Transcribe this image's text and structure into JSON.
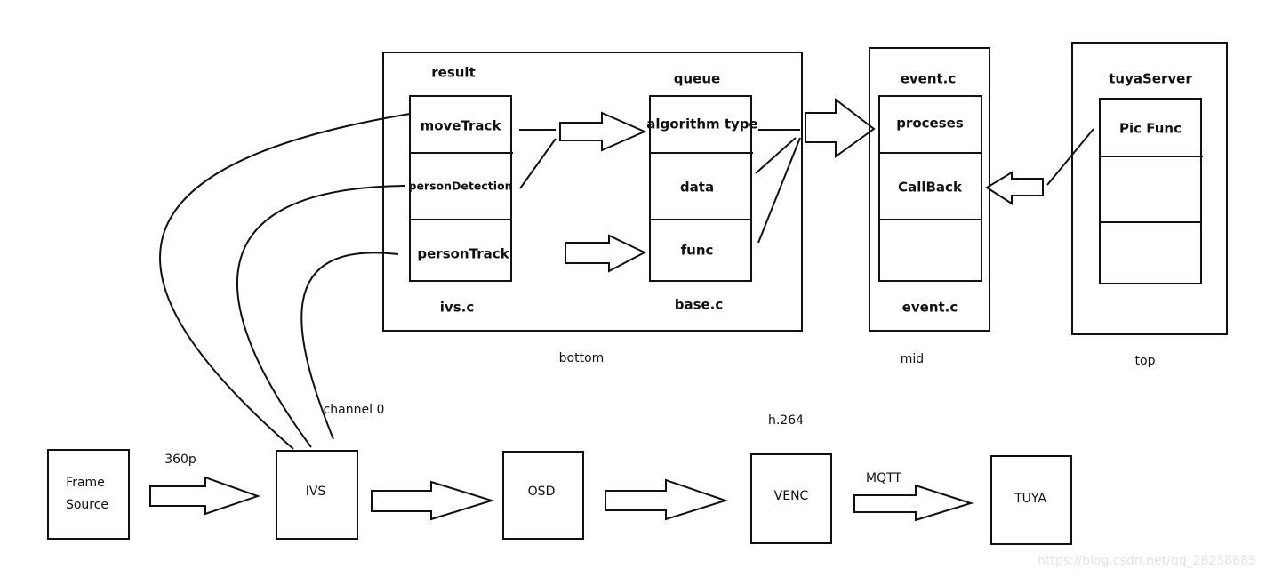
{
  "bottom_group": {
    "label": "bottom",
    "ivs": {
      "title": "result",
      "items": [
        "moveTrack",
        "personDetection",
        "personTrack"
      ],
      "file": "ivs.c"
    },
    "base": {
      "title": "queue",
      "items": [
        "algorithm type",
        "data",
        "func"
      ],
      "file": "base.c"
    }
  },
  "mid_group": {
    "label": "mid",
    "title": "event.c",
    "items": [
      "proceses",
      "CallBack",
      ""
    ],
    "file": "event.c"
  },
  "top_group": {
    "label": "top",
    "title": "tuyaServer",
    "items": [
      "Pic Func",
      "",
      ""
    ]
  },
  "pipeline": {
    "frame_source": [
      "Frame",
      "Source"
    ],
    "ivs": "IVS",
    "osd": "OSD",
    "venc": "VENC",
    "tuya": "TUYA",
    "res_label": "360p",
    "channel_label": "channel 0",
    "codec_label": "h.264",
    "protocol_label": "MQTT"
  },
  "watermark": "https://blog.csdn.net/qq_28258885"
}
